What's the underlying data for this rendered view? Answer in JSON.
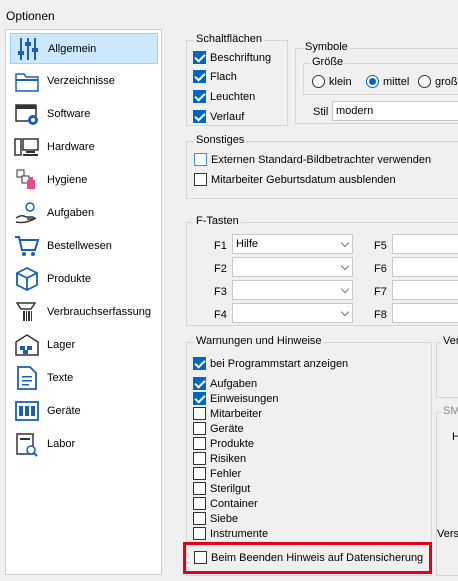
{
  "window": {
    "title": "Optionen"
  },
  "sidebar": {
    "items": [
      {
        "label": "Allgemein",
        "icon": "sliders-icon",
        "selected": true
      },
      {
        "label": "Verzeichnisse",
        "icon": "folder-icon",
        "selected": false
      },
      {
        "label": "Software",
        "icon": "software-gear-icon",
        "selected": false
      },
      {
        "label": "Hardware",
        "icon": "computer-icon",
        "selected": false
      },
      {
        "label": "Hygiene",
        "icon": "hygiene-icon",
        "selected": false
      },
      {
        "label": "Aufgaben",
        "icon": "hand-task-icon",
        "selected": false
      },
      {
        "label": "Bestellwesen",
        "icon": "shopping-cart-icon",
        "selected": false
      },
      {
        "label": "Produkte",
        "icon": "package-box-icon",
        "selected": false
      },
      {
        "label": "Verbrauchserfassung",
        "icon": "barcode-scanner-icon",
        "selected": false
      },
      {
        "label": "Lager",
        "icon": "warehouse-icon",
        "selected": false
      },
      {
        "label": "Texte",
        "icon": "text-document-icon",
        "selected": false
      },
      {
        "label": "Geräte",
        "icon": "devices-icon",
        "selected": false
      },
      {
        "label": "Labor",
        "icon": "lab-icon",
        "selected": false
      }
    ]
  },
  "schaltflaechen": {
    "title": "Schaltflächen",
    "options": [
      {
        "label": "Beschriftung",
        "checked": true
      },
      {
        "label": "Flach",
        "checked": true
      },
      {
        "label": "Leuchten",
        "checked": true
      },
      {
        "label": "Verlauf",
        "checked": true
      }
    ]
  },
  "symbole": {
    "title": "Symbole",
    "groesse_title": "Größe",
    "sizes": [
      {
        "label": "klein",
        "selected": false
      },
      {
        "label": "mittel",
        "selected": true
      },
      {
        "label": "groß",
        "selected": false
      }
    ],
    "stil_label": "Stil",
    "stil_value": "modern"
  },
  "sonstiges": {
    "title": "Sonstiges",
    "options": [
      {
        "label": "Externen Standard-Bildbetrachter verwenden",
        "checked": false
      },
      {
        "label": "Mitarbeiter Geburtsdatum ausblenden",
        "checked": false
      }
    ]
  },
  "ftasten": {
    "title": "F-Tasten",
    "keys": [
      {
        "label": "F1",
        "value": "Hilfe"
      },
      {
        "label": "F2",
        "value": ""
      },
      {
        "label": "F3",
        "value": ""
      },
      {
        "label": "F4",
        "value": ""
      },
      {
        "label": "F5",
        "value": ""
      },
      {
        "label": "F6",
        "value": ""
      },
      {
        "label": "F7",
        "value": ""
      },
      {
        "label": "F8",
        "value": ""
      }
    ]
  },
  "warnungen": {
    "title": "Warnungen und Hinweise",
    "startup": {
      "label": "bei Programmstart anzeigen",
      "checked": true
    },
    "items": [
      {
        "label": "Aufgaben",
        "checked": true
      },
      {
        "label": "Einweisungen",
        "checked": true
      },
      {
        "label": "Mitarbeiter",
        "checked": false
      },
      {
        "label": "Geräte",
        "checked": false
      },
      {
        "label": "Produkte",
        "checked": false
      },
      {
        "label": "Risiken",
        "checked": false
      },
      {
        "label": "Fehler",
        "checked": false
      },
      {
        "label": "Sterilgut",
        "checked": false
      },
      {
        "label": "Container",
        "checked": false
      },
      {
        "label": "Siebe",
        "checked": false
      },
      {
        "label": "Instrumente",
        "checked": false
      }
    ],
    "shutdown": {
      "label": "Beim Beenden Hinweis auf Datensicherung",
      "checked": false
    }
  },
  "right_partial": {
    "ver_title": "Ver",
    "sm_title": "SM",
    "h_label": "H",
    "vers_label": "Vers"
  },
  "colors": {
    "accent": "#0067c0",
    "selection": "#cce8ff",
    "highlight": "#e3001b"
  }
}
